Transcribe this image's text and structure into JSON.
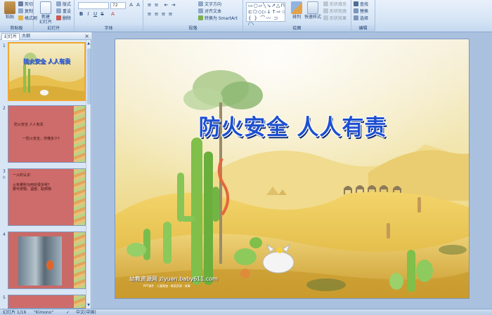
{
  "ribbon": {
    "clipboard": {
      "label": "剪贴板",
      "paste_label": "粘贴",
      "cut_label": "剪切",
      "copy_label": "复制",
      "format_painter_label": "格式刷"
    },
    "slides": {
      "label": "幻灯片",
      "new_slide_label": "新建\n幻灯片",
      "layout_label": "版式",
      "reset_label": "重设",
      "delete_label": "删除"
    },
    "font": {
      "label": "字体",
      "font_size": "72"
    },
    "paragraph": {
      "label": "段落",
      "text_direction_label": "文字方向",
      "align_text_label": "对齐文本",
      "smartart_label": "转换为 SmartArt"
    },
    "drawing": {
      "label": "绘图",
      "arrange_label": "排列",
      "quick_styles_label": "快速样式",
      "shape_fill_label": "形状填充",
      "shape_outline_label": "形状轮廓",
      "shape_effects_label": "形状效果"
    },
    "editing": {
      "label": "编辑",
      "find_label": "查找",
      "replace_label": "替换",
      "select_label": "选择"
    }
  },
  "pane": {
    "tab_slides": "幻灯片",
    "tab_outline": "大纲",
    "close_label": "×",
    "slides": [
      {
        "number": "1",
        "title": "防火安全 人人有责"
      },
      {
        "number": "2",
        "title": "防火安全  人人有责",
        "body": "一防火安全，你懂多少?"
      },
      {
        "number": "3",
        "title": "一火的认识",
        "body": "火有哪些功用处很多呢?\n要可燃物、温度、助燃物",
        "icon": "☼"
      },
      {
        "number": "4"
      },
      {
        "number": "5"
      }
    ]
  },
  "slide": {
    "title": "防火安全  人人有责",
    "watermark": "幼教资源网 ziyuan.baby611.com",
    "watermark_sub": "PPT课件 · 儿童歌曲 · 教案资源 · 故事"
  },
  "status": {
    "slide_info": "幻灯片 1/16",
    "theme": "\"Kimono\"",
    "language": "中文(中国)"
  },
  "colors": {
    "title_blue": "#1d4fd0",
    "ribbon_blue": "#d3e3f5",
    "thumb_red": "#cd6c6a",
    "selected_border": "#f0a830"
  }
}
